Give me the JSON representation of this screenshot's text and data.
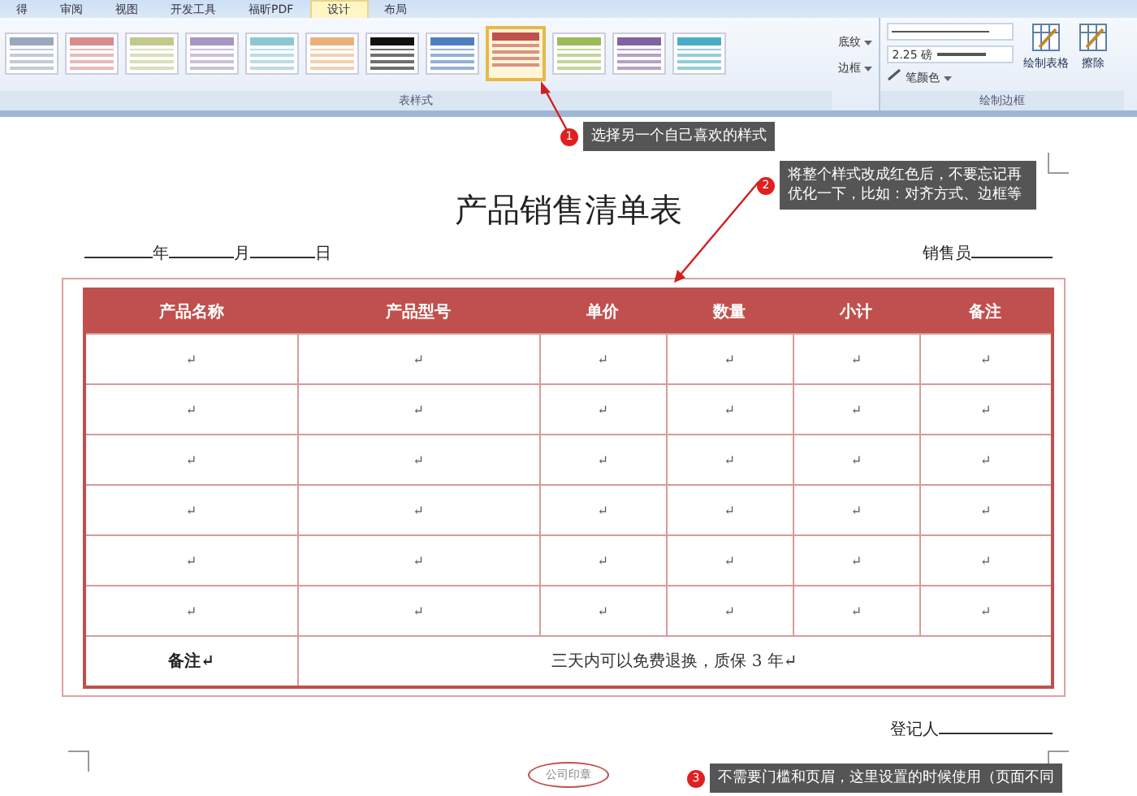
{
  "ribbon": {
    "tabs": [
      {
        "label": "得",
        "selected": false
      },
      {
        "label": "审阅",
        "selected": false
      },
      {
        "label": "视图",
        "selected": false
      },
      {
        "label": "开发工具",
        "selected": false
      },
      {
        "label": "福昕PDF",
        "selected": false
      },
      {
        "label": "设计",
        "selected": true
      },
      {
        "label": "布局",
        "selected": false
      }
    ],
    "styles": [
      {
        "color": "#9aa8bb",
        "selected": false
      },
      {
        "color": "#d98c8c",
        "selected": false
      },
      {
        "color": "#c3c98c",
        "selected": false
      },
      {
        "color": "#a996c0",
        "selected": false
      },
      {
        "color": "#8cc7d4",
        "selected": false
      },
      {
        "color": "#eab07c",
        "selected": false
      },
      {
        "color": "#111111",
        "selected": false
      },
      {
        "color": "#4f7fc0",
        "selected": false
      },
      {
        "color": "#c0504d",
        "selected": true
      },
      {
        "color": "#9bbb59",
        "selected": false
      },
      {
        "color": "#8064a2",
        "selected": false
      },
      {
        "color": "#4bacc6",
        "selected": false
      }
    ],
    "styles_group": "表样式",
    "shading": "底纹",
    "borders": "边框",
    "pen_weight": "2.25 磅",
    "pen_color": "笔颜色",
    "draw_table": "绘制表格",
    "eraser": "擦除",
    "borders_group": "绘制边框"
  },
  "document": {
    "title": "产品销售清单表",
    "date_year": "年",
    "date_month": "月",
    "date_day": "日",
    "seller": "销售员",
    "table": {
      "columns": [
        "产品名称",
        "产品型号",
        "单价",
        "数量",
        "小计",
        "备注"
      ],
      "rows": [
        [
          "↵",
          "↵",
          "↵",
          "↵",
          "↵",
          "↵"
        ],
        [
          "↵",
          "↵",
          "↵",
          "↵",
          "↵",
          "↵"
        ],
        [
          "↵",
          "↵",
          "↵",
          "↵",
          "↵",
          "↵"
        ],
        [
          "↵",
          "↵",
          "↵",
          "↵",
          "↵",
          "↵"
        ],
        [
          "↵",
          "↵",
          "↵",
          "↵",
          "↵",
          "↵"
        ],
        [
          "↵",
          "↵",
          "↵",
          "↵",
          "↵",
          "↵"
        ]
      ],
      "note_label": "备注↵",
      "note_text": "三天内可以免费退换，质保 3 年↵"
    },
    "registrar": "登记人",
    "footer_stamp": "公司印章"
  },
  "callouts": [
    {
      "number": "1",
      "text": "选择另一个自己喜欢的样式"
    },
    {
      "number": "2",
      "text": "将整个样式改成红色后，不要忘记再优化一下，比如：对齐方式、边框等"
    },
    {
      "number": "3",
      "text": "不需要门槛和页眉，这里设置的时候使用（页面不同"
    }
  ]
}
